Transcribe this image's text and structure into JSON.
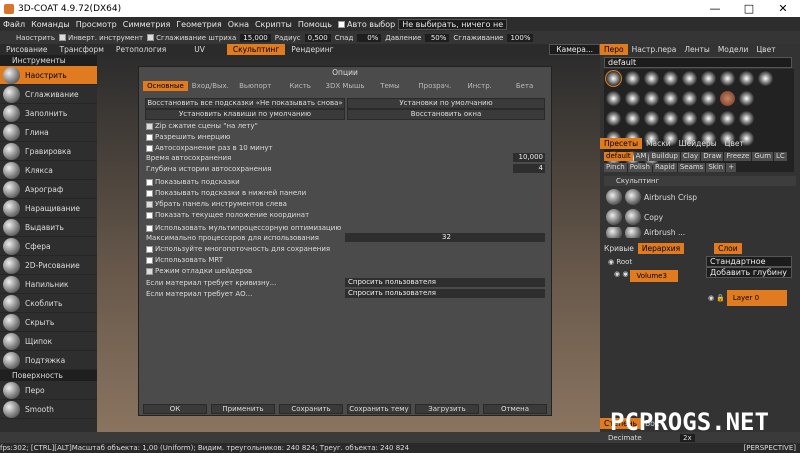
{
  "app": {
    "title": "3D-COAT 4.9.72(DX64)"
  },
  "window_controls": {
    "minimize": "—",
    "maximize": "□",
    "close": "✕"
  },
  "menu": [
    "Файл",
    "Команды",
    "Просмотр",
    "Симметрия",
    "Геометрия",
    "Окна",
    "Скрипты",
    "Помощь"
  ],
  "menu_extra": {
    "auto_select": "Авто выбор",
    "select_mode": "Не выбирать, ничего не"
  },
  "toolbar": {
    "sharpen": "Наострить",
    "invert": "Инверт. инструмент",
    "smooth_stroke": "Сглаживание штриха",
    "smooth_stroke_val": "15,000",
    "radius": "Радиус",
    "radius_val": "0,500",
    "falloff": "Спад",
    "falloff_val": "0%",
    "pressure": "Давление",
    "pressure_val": "50%",
    "smoothing": "Сглаживание",
    "smoothing_val": "100%"
  },
  "rooms": [
    "Рисование",
    "Трансформ",
    "Ретопология",
    "UV",
    "Скульптинг",
    "Рендеринг"
  ],
  "rooms_active": 4,
  "camera": "Камера...",
  "left_panel": {
    "header": "Инструменты",
    "tools": [
      "Наострить",
      "Сглаживание",
      "Заполнить",
      "Глина",
      "Гравировка",
      "Клякса",
      "Аэрограф",
      "Наращивание",
      "Выдавить",
      "Сфера",
      "2D-Рисование",
      "Напильник",
      "Скоблить",
      "Скрыть",
      "Щипок",
      "Подтяжка"
    ],
    "header2": "Поверхность",
    "tools2": [
      "Перо",
      "Smooth"
    ]
  },
  "dialog": {
    "title": "Опции",
    "tabs": [
      "Основные",
      "Вход/Вых.",
      "Вьюпорт",
      "Кисть",
      "3DX Мышь",
      "Темы",
      "Прозрач.",
      "Инстр.",
      "Бета"
    ],
    "btn_restore_hints": "Восстановить все подсказки «Не показывать снова»",
    "btn_default_settings": "Установки по умолчанию",
    "btn_default_keys": "Установить клавиши по умолчанию",
    "btn_restore_windows": "Восстановить окна",
    "opt_zip": "Zip сжатие сцены \"на лету\"",
    "opt_inertia": "Разрешить инерцию",
    "opt_autosave": "Автосохранение раз в 10 минут",
    "autosave_time_label": "Время автосохранения",
    "autosave_time_val": "10,000",
    "undo_depth_label": "Глубина истории автосохранения",
    "undo_depth_val": "4",
    "opt_show_hints": "Показывать подсказки",
    "opt_hints_bottom": "Показывать подсказки в нижней панели",
    "opt_remove_panel": "Убрать панель инструментов слева",
    "opt_show_coords": "Показать текущее положение координат",
    "opt_multicore": "Использовать мультипроцессорную оптимизацию",
    "max_procs_label": "Максимально процессоров для использования",
    "max_procs_val": "32",
    "opt_multithread_save": "Используйте многопоточность для сохранения",
    "opt_mrt": "Использовать MRT",
    "opt_shader_debug": "Режим отладки шейдеров",
    "curv_label": "Если материал требует кривизну...",
    "curv_val": "Спросить пользователя",
    "ao_label": "Если материал требует АО...",
    "ao_val": "Спросить пользователя",
    "bottom": [
      "ОК",
      "Применить",
      "Сохранить",
      "Сохранить тему",
      "Загрузить",
      "Отмена"
    ]
  },
  "right_panel": {
    "top_tabs": [
      "Перо",
      "Настр.пера",
      "Ленты",
      "Модели",
      "Цвет"
    ],
    "brush_set": "default",
    "mid_tabs": [
      "Пресеты",
      "Маски",
      "Шейдеры",
      "Цвет"
    ],
    "preset_tags": [
      "default",
      "AM",
      "Buildup",
      "Clay",
      "Draw",
      "Freeze",
      "Gum",
      "LC",
      "Pinch",
      "Polish",
      "Rapid",
      "Seams",
      "Skin",
      "+"
    ],
    "sculpt_header": "Скульптинг",
    "presets": [
      "Airbrush Crisp",
      "Copy",
      "Airbrush ..."
    ],
    "layer_tabs": [
      "Кривые",
      "Иерархия"
    ],
    "tree": [
      "Root",
      "Volume3"
    ],
    "layers_tab": "Слои",
    "blend_mode": "Стандартное",
    "add_depth": "Добавить глубину",
    "layer_name": "Layer 0",
    "bottom_tabs": [
      "Степень",
      "Вок"
    ],
    "decimate": "Decimate",
    "decimate_val": "2x"
  },
  "status": {
    "text": "fps:302; [CTRL][ALT]Масштаб объекта: 1,00 (Uniform); Видим. треугольников: 240 824; Треуг. объекта: 240 824",
    "view": "[PERSPECTIVE]"
  },
  "watermark": "PCPROGS.NET",
  "colors": {
    "accent": "#e07b1f",
    "panel": "#2e2e2e",
    "dialog": "#4b4b4b"
  }
}
